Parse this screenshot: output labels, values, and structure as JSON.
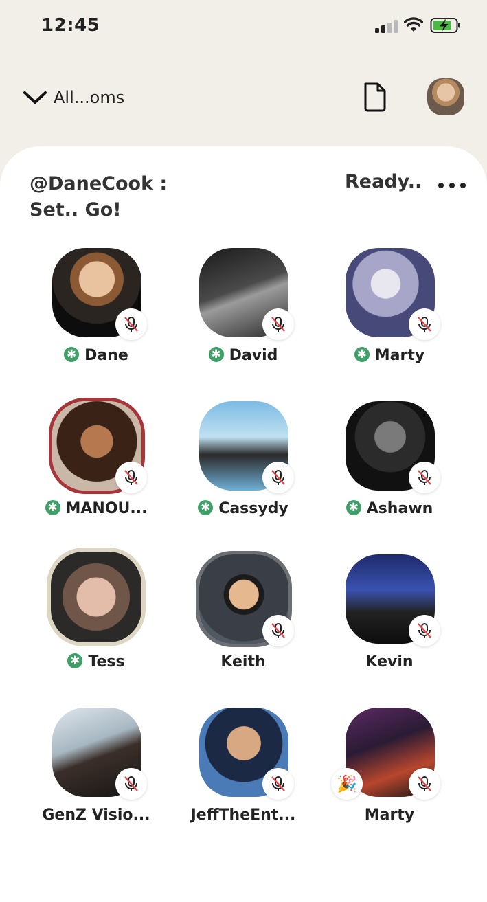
{
  "status_bar": {
    "time": "12:45"
  },
  "header": {
    "room_picker_label": "All...oms"
  },
  "room": {
    "title": "@DaneCook : Set.. Go!",
    "status": "Ready.."
  },
  "colors": {
    "moderator_badge": "#3e9f67",
    "mute_slash": "#e0464a",
    "panel_bg": "#ffffff",
    "page_bg": "#f1efe7"
  },
  "speakers": [
    {
      "name": "Dane",
      "moderator": true,
      "muted": true
    },
    {
      "name": "David",
      "moderator": true,
      "muted": true
    },
    {
      "name": "Marty",
      "moderator": true,
      "muted": true
    },
    {
      "name": "MANOU...",
      "moderator": true,
      "muted": true
    },
    {
      "name": "Cassydy",
      "moderator": true,
      "muted": true
    },
    {
      "name": "Ashawn",
      "moderator": true,
      "muted": true
    },
    {
      "name": "Tess",
      "moderator": true,
      "muted": false
    },
    {
      "name": "Keith",
      "moderator": false,
      "muted": true
    },
    {
      "name": "Kevin",
      "moderator": false,
      "muted": true
    },
    {
      "name": "GenZ Visio...",
      "moderator": false,
      "muted": true
    },
    {
      "name": "JeffTheEnt...",
      "moderator": false,
      "muted": true
    },
    {
      "name": "Marty",
      "moderator": false,
      "muted": true,
      "new_badge": "party-popper-icon"
    }
  ],
  "icons": {
    "room_picker": "chevron-down-icon",
    "document": "document-icon",
    "more": "more-horizontal-icon",
    "muted": "microphone-muted-icon",
    "moderator": "moderator-asterisk-icon"
  }
}
